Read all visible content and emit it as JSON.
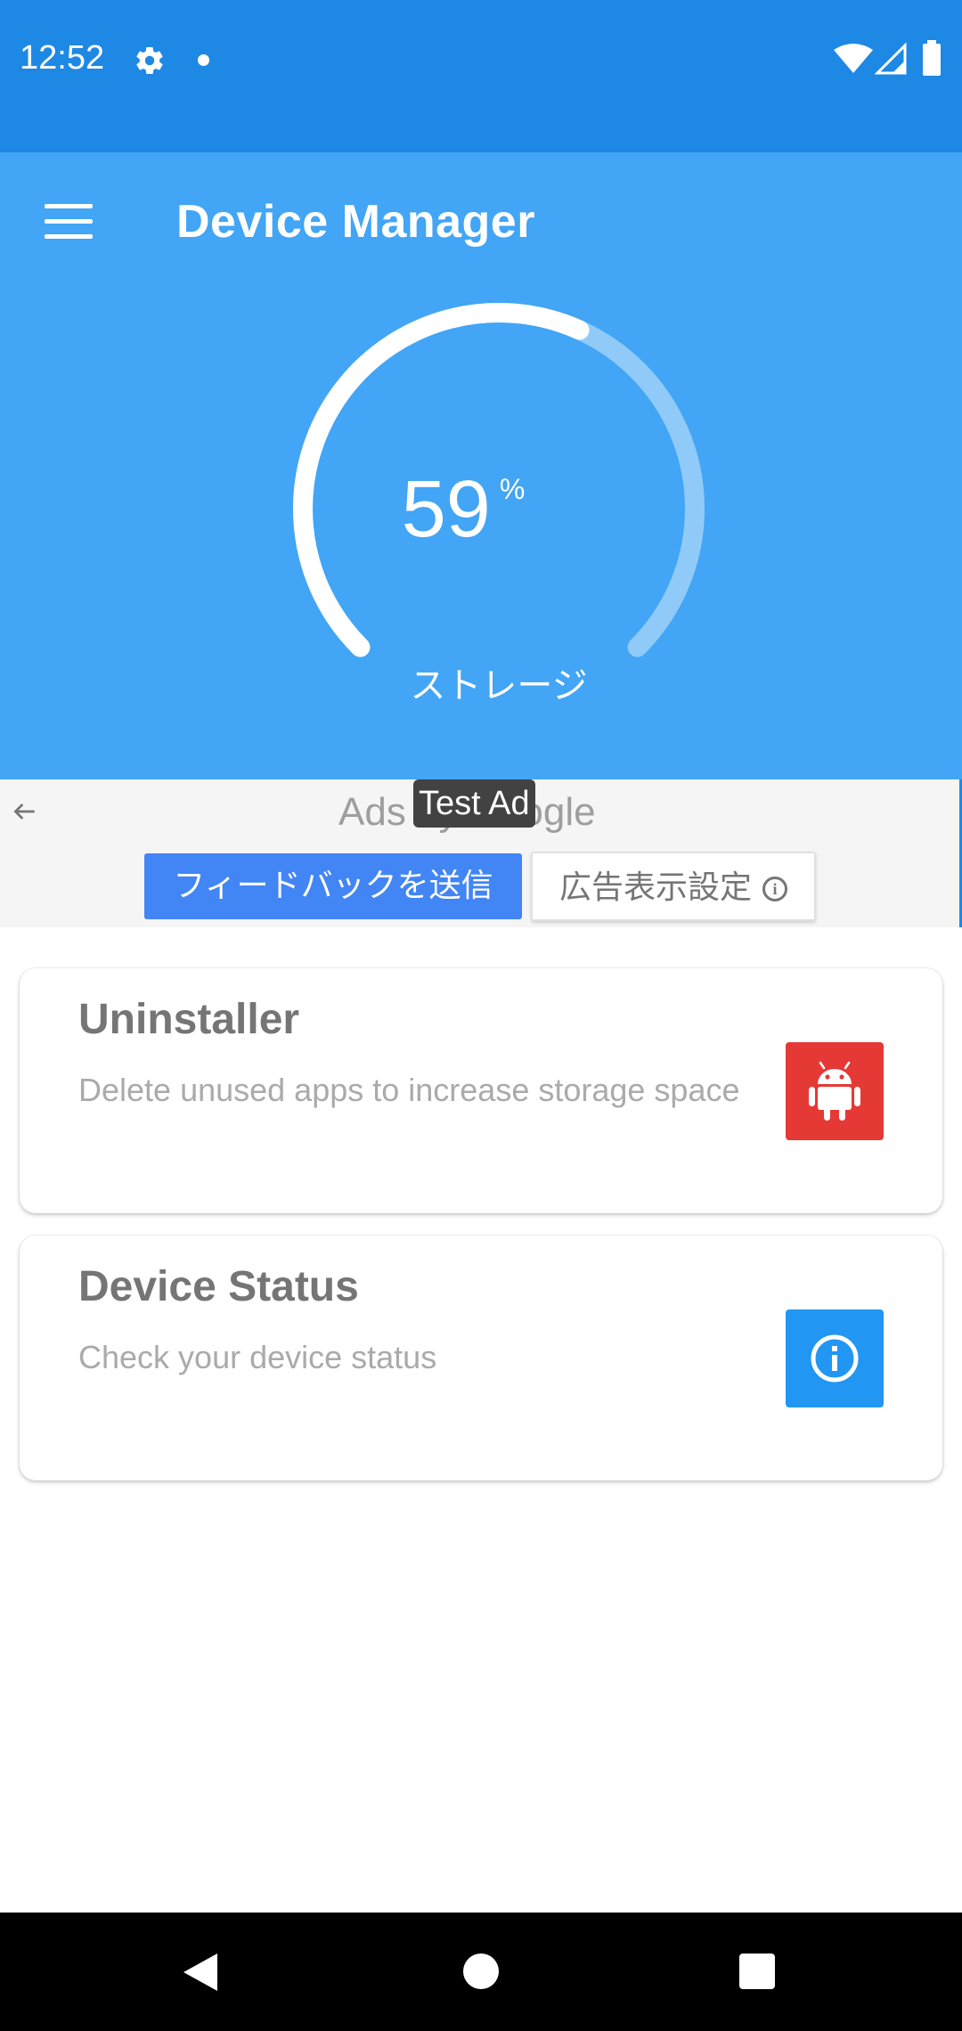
{
  "status_bar": {
    "time": "12:52"
  },
  "header": {
    "title": "Device Manager",
    "storage_percent": 59,
    "storage_value": "59",
    "storage_unit": "%",
    "storage_label": "ストレージ"
  },
  "ad": {
    "ads_by": "Ads by Google",
    "test_badge": "Test Ad",
    "feedback_label": "フィードバックを送信",
    "settings_label": "広告表示設定"
  },
  "cards": [
    {
      "title": "Uninstaller",
      "description": "Delete unused apps to increase storage space",
      "icon": "android-icon",
      "color": "#e53935"
    },
    {
      "title": "Device Status",
      "description": "Check your device status",
      "icon": "info-icon",
      "color": "#2196f3"
    }
  ],
  "colors": {
    "status_bar": "#1e88e5",
    "header": "#42a5f5",
    "gauge_track": "#90caf9",
    "gauge_progress": "#ffffff"
  }
}
